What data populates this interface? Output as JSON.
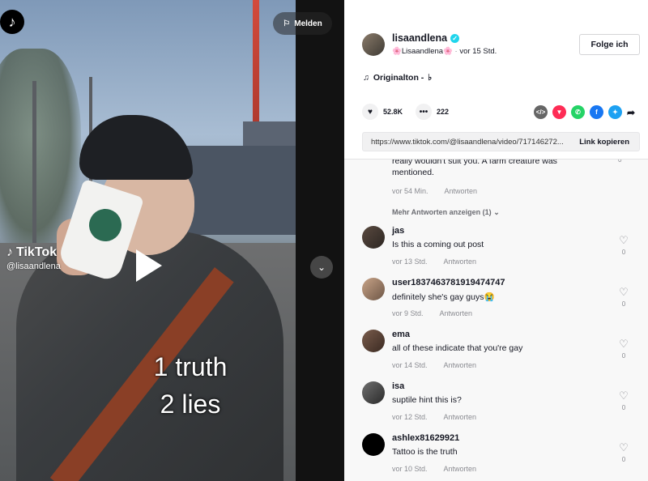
{
  "video": {
    "report_label": "Melden",
    "watermark_brand": "TikTok",
    "watermark_handle": "@lisaandlena",
    "caption_line1": "1 truth",
    "caption_line2": "2 lies"
  },
  "author": {
    "username": "lisaandlena",
    "nickname": "🌸Lisaandlena🌸",
    "separator": "·",
    "posted": "vor 15 Std.",
    "follow_label": "Folge ich"
  },
  "sound": {
    "label": "Originalton - "
  },
  "stats": {
    "likes": "52.8K",
    "comments": "222"
  },
  "share": {
    "icons": [
      "embed-icon",
      "send-icon",
      "whatsapp-icon",
      "facebook-icon",
      "twitter-icon",
      "share-arrow-icon"
    ],
    "colors": {
      "embed": "#666666",
      "send": "#fe2c55",
      "whatsapp": "#25d366",
      "facebook": "#1877f2",
      "twitter": "#1da1f2"
    }
  },
  "link": {
    "url": "https://www.tiktok.com/@lisaandlena/video/717146272...",
    "copy_label": "Link kopieren"
  },
  "partial_comment": {
    "text_line1": "really wouldn't suit you. A farm creature was",
    "text_line2": "mentioned.",
    "time": "vor 54 Min.",
    "reply_label": "Antworten",
    "likes": "0"
  },
  "more_replies_label": "Mehr Antworten anzeigen (1)",
  "comments": [
    {
      "user": "jas",
      "text": "Is this a coming out post",
      "time": "vor 13 Std.",
      "reply_label": "Antworten",
      "likes": "0"
    },
    {
      "user": "user1837463781919474747",
      "text": "definitely she's gay guys😭",
      "time": "vor 9 Std.",
      "reply_label": "Antworten",
      "likes": "0"
    },
    {
      "user": "ema",
      "text": "all of these indicate that you're gay",
      "time": "vor 14 Std.",
      "reply_label": "Antworten",
      "likes": "0"
    },
    {
      "user": "isa",
      "text": "suptile hint this is?",
      "time": "vor 12 Std.",
      "reply_label": "Antworten",
      "likes": "0"
    },
    {
      "user": "ashlex81629921",
      "text": "Tattoo is the truth",
      "time": "vor 10 Std.",
      "reply_label": "Antworten",
      "likes": "0"
    }
  ]
}
